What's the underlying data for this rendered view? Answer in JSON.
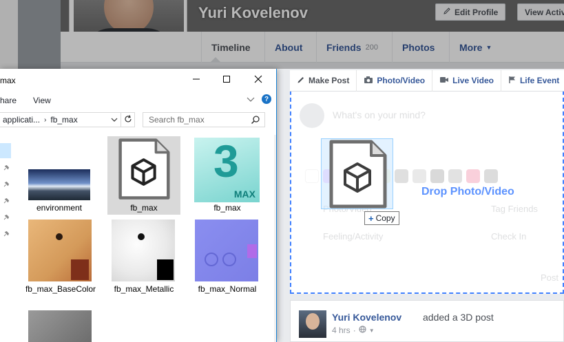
{
  "facebook": {
    "profile_name": "Yuri Kovelenov",
    "edit_profile_label": "Edit Profile",
    "view_activity_label": "View Activ",
    "tabs": [
      {
        "label": "Timeline"
      },
      {
        "label": "About"
      },
      {
        "label": "Friends",
        "count": "200"
      },
      {
        "label": "Photos"
      },
      {
        "label": "More"
      }
    ],
    "composer": {
      "tabs": [
        "Make Post",
        "Photo/Video",
        "Live Video",
        "Life Event"
      ],
      "placeholder": "What's on your mind?",
      "drop_label": "Drop Photo/Video",
      "faded_options": [
        "Photo/Video",
        "Tag Friends",
        "Feeling/Activity",
        "Check In"
      ],
      "post_button": "Post",
      "copy_tooltip": "Copy"
    },
    "post": {
      "author": "Yuri Kovelenov",
      "action": "added a 3D post",
      "time": "4 hrs"
    },
    "colors": {
      "link_blue": "#365899",
      "drop_blue": "#4080ff"
    }
  },
  "explorer": {
    "title": "max",
    "ribbon": {
      "share": "hare",
      "view": "View"
    },
    "address": {
      "parent": "applicati...",
      "current": "fb_max"
    },
    "search_placeholder": "Search fb_max",
    "items": [
      {
        "name": "environment"
      },
      {
        "name": "fb_max"
      },
      {
        "name": "fb_max"
      },
      {
        "name": "fb_max_BaseColor"
      },
      {
        "name": "fb_max_Metallic"
      },
      {
        "name": "fb_max_Normal"
      }
    ],
    "max_badge": "MAX",
    "max_number": "3"
  }
}
